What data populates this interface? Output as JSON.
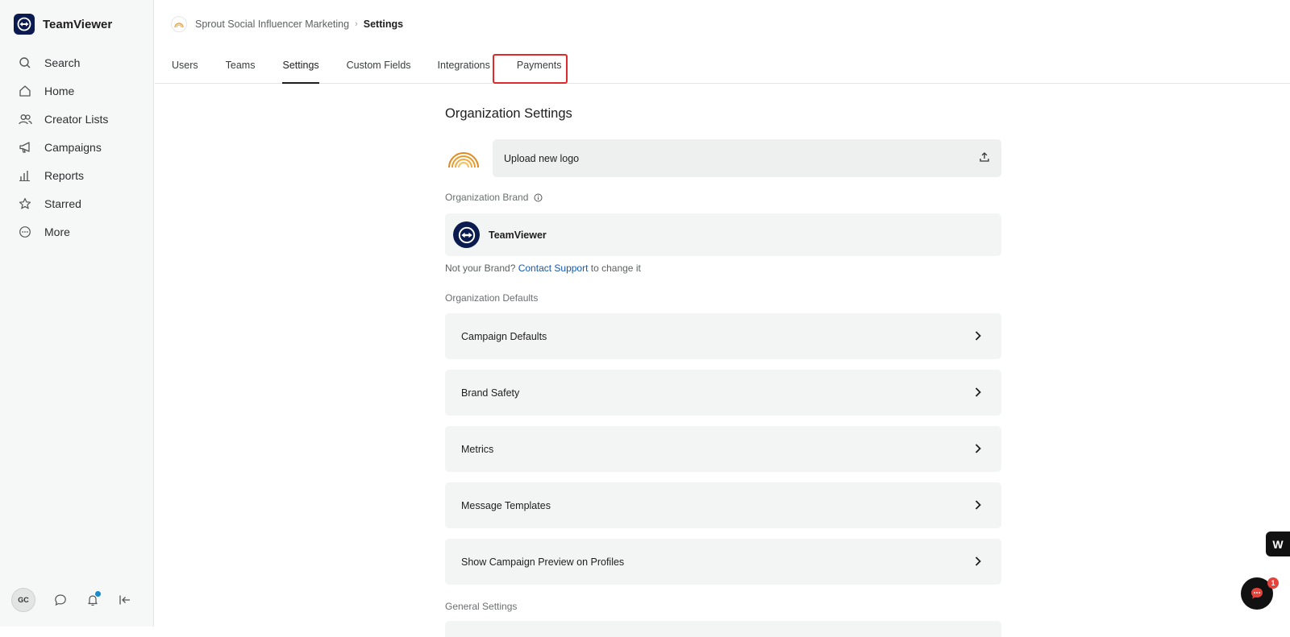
{
  "app": {
    "name": "TeamViewer"
  },
  "sidebar": {
    "items": [
      {
        "label": "Search",
        "icon": "search-icon"
      },
      {
        "label": "Home",
        "icon": "home-icon"
      },
      {
        "label": "Creator Lists",
        "icon": "users-icon"
      },
      {
        "label": "Campaigns",
        "icon": "megaphone-icon"
      },
      {
        "label": "Reports",
        "icon": "bar-chart-icon"
      },
      {
        "label": "Starred",
        "icon": "star-icon"
      },
      {
        "label": "More",
        "icon": "more-icon"
      }
    ],
    "bottom": {
      "avatar_initials": "GC"
    }
  },
  "breadcrumb": {
    "org": "Sprout Social Influencer Marketing",
    "separator": "›",
    "current": "Settings"
  },
  "tabs": [
    {
      "label": "Users"
    },
    {
      "label": "Teams"
    },
    {
      "label": "Settings",
      "active": true
    },
    {
      "label": "Custom Fields",
      "highlighted": true
    },
    {
      "label": "Integrations"
    },
    {
      "label": "Payments"
    }
  ],
  "main": {
    "title": "Organization Settings",
    "upload_label": "Upload new logo",
    "brand_section_label": "Organization Brand",
    "brand_name": "TeamViewer",
    "note_prefix": "Not your Brand? ",
    "note_link": "Contact Support",
    "note_suffix": " to change it",
    "defaults_label": "Organization Defaults",
    "default_rows": [
      {
        "label": "Campaign Defaults"
      },
      {
        "label": "Brand Safety"
      },
      {
        "label": "Metrics"
      },
      {
        "label": "Message Templates"
      },
      {
        "label": "Show Campaign Preview on Profiles"
      }
    ],
    "general_label": "General Settings"
  },
  "widgets": {
    "w_badge": "W",
    "chat_count": "1"
  },
  "colors": {
    "brand_navy": "#0b1a4f",
    "link": "#1459b0",
    "highlight": "#e0292b",
    "notification": "#e5443c",
    "logo_orange": "#e99a2c"
  }
}
